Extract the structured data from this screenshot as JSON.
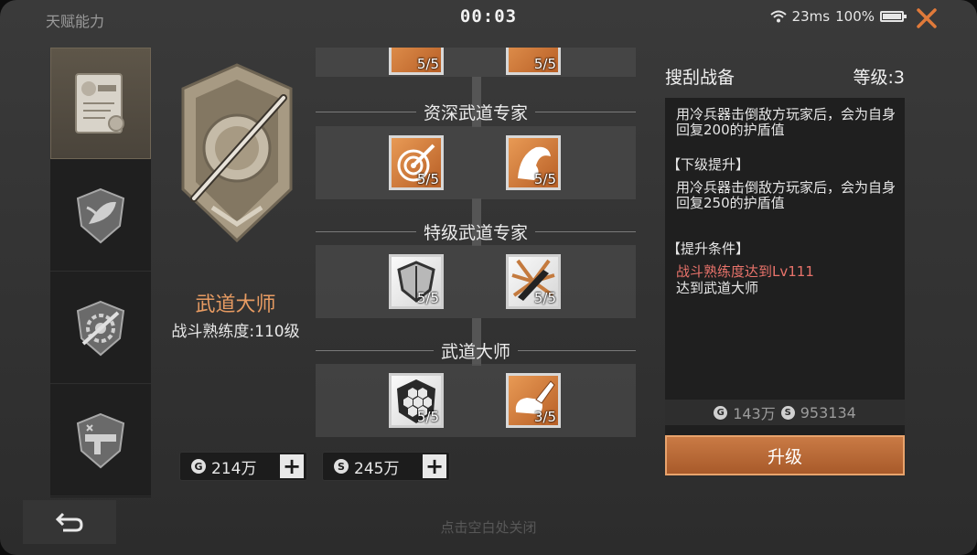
{
  "header": {
    "title": "天赋能力",
    "timer": "00:03",
    "latency": "23ms",
    "battery": "100%",
    "battery_level": 1.0
  },
  "sidebar": {
    "tabs": [
      {
        "icon": "trade-certificate-icon",
        "active": true
      },
      {
        "icon": "leaf-shield-icon",
        "active": false
      },
      {
        "icon": "gear-hammer-icon",
        "active": false
      },
      {
        "icon": "gun-badge-icon",
        "active": false
      }
    ]
  },
  "rank": {
    "name": "武道大师",
    "level": "战斗熟练度:110级"
  },
  "currencies": [
    {
      "icon": "G",
      "value": "214万"
    },
    {
      "icon": "S",
      "value": "245万"
    }
  ],
  "tree": {
    "top_skills": [
      {
        "count": "5/5",
        "icon": "partial-skill-icon",
        "style": "orange"
      },
      {
        "count": "5/5",
        "icon": "partial-skill-icon",
        "style": "orange"
      }
    ],
    "tiers": [
      {
        "title": "资深武道专家",
        "skills": [
          {
            "count": "5/5",
            "icon": "target-knife-icon",
            "style": "orange"
          },
          {
            "count": "5/5",
            "icon": "beast-claw-icon",
            "style": "orange"
          }
        ]
      },
      {
        "title": "特级武道专家",
        "skills": [
          {
            "count": "5/5",
            "icon": "shield-icon",
            "style": "white"
          },
          {
            "count": "5/5",
            "icon": "dagger-burst-icon",
            "style": "white"
          }
        ]
      },
      {
        "title": "武道大师",
        "skills": [
          {
            "count": "5/5",
            "icon": "hexagon-shield-icon",
            "style": "white"
          },
          {
            "count": "3/5",
            "icon": "blade-hand-icon",
            "style": "orange"
          }
        ]
      }
    ]
  },
  "detail": {
    "skill_name": "搜刮战备",
    "level": "等级:3",
    "current_effect": "用冷兵器击倒敌方玩家后，会为自身回复200的护盾值",
    "next_label": "【下级提升】",
    "next_effect": "用冷兵器击倒敌方玩家后，会为自身回复250的护盾值",
    "req_label": "【提升条件】",
    "req_unmet": "战斗熟练度达到Lv111",
    "req_met": "达到武道大师",
    "cost_g": "143万",
    "cost_s": "953134",
    "upgrade_label": "升级"
  },
  "footer": {
    "hint": "点击空白处关闭"
  },
  "colors": {
    "accent_orange": "#e79b62",
    "button_orange": "#b8652f",
    "requirement_red": "#e9736b"
  }
}
